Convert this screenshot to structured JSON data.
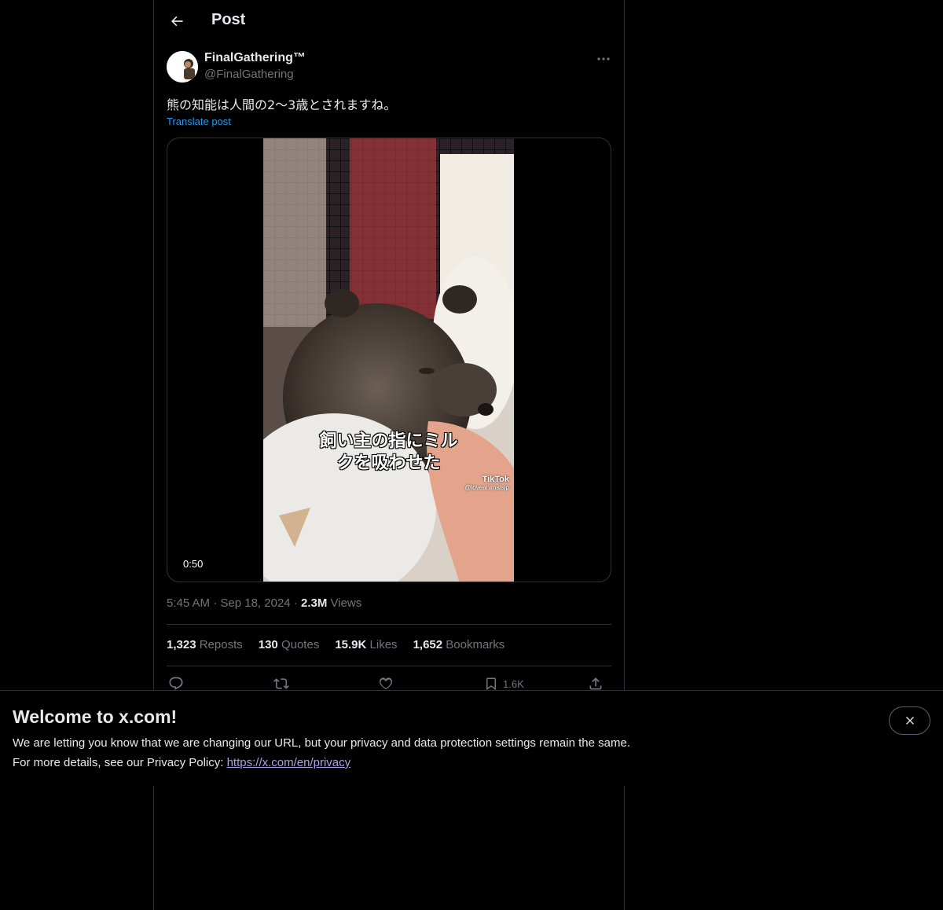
{
  "header": {
    "title": "Post",
    "back_icon": "arrow-left-icon"
  },
  "author": {
    "display_name": "FinalGathering™",
    "handle": "@FinalGathering",
    "more_icon": "more-horizontal-icon"
  },
  "post": {
    "text": "熊の知能は人間の2〜3歳とされますね。",
    "translate_label": "Translate post"
  },
  "media": {
    "caption": "飼い主の指にミル\nクを吸わせた",
    "watermark_brand": "TikTok",
    "watermark_handle": "@loveanimalsjp",
    "duration": "0:50"
  },
  "meta": {
    "time": "5:45 AM",
    "date": "Sep 18, 2024",
    "views_count": "2.3M",
    "views_label": "Views",
    "separator": "·"
  },
  "stats": [
    {
      "count": "1,323",
      "label": "Reposts"
    },
    {
      "count": "130",
      "label": "Quotes"
    },
    {
      "count": "15.9K",
      "label": "Likes"
    },
    {
      "count": "1,652",
      "label": "Bookmarks"
    }
  ],
  "actions": {
    "reply_icon": "reply-icon",
    "repost_icon": "repost-icon",
    "like_icon": "heart-icon",
    "bookmark_icon": "bookmark-icon",
    "bookmark_count": "1.6K",
    "share_icon": "share-icon"
  },
  "banner": {
    "title": "Welcome to x.com!",
    "line1": "We are letting you know that we are changing our URL, but your privacy and data protection settings remain the same.",
    "line2_prefix": "For more details, see our Privacy Policy: ",
    "link": "https://x.com/en/privacy",
    "close_icon": "close-icon"
  },
  "colors": {
    "background": "#000000",
    "text": "#e7e9ea",
    "muted": "#71767b",
    "accent": "#1d9bf0",
    "link": "#a8a3e6",
    "border": "#2f3336"
  }
}
